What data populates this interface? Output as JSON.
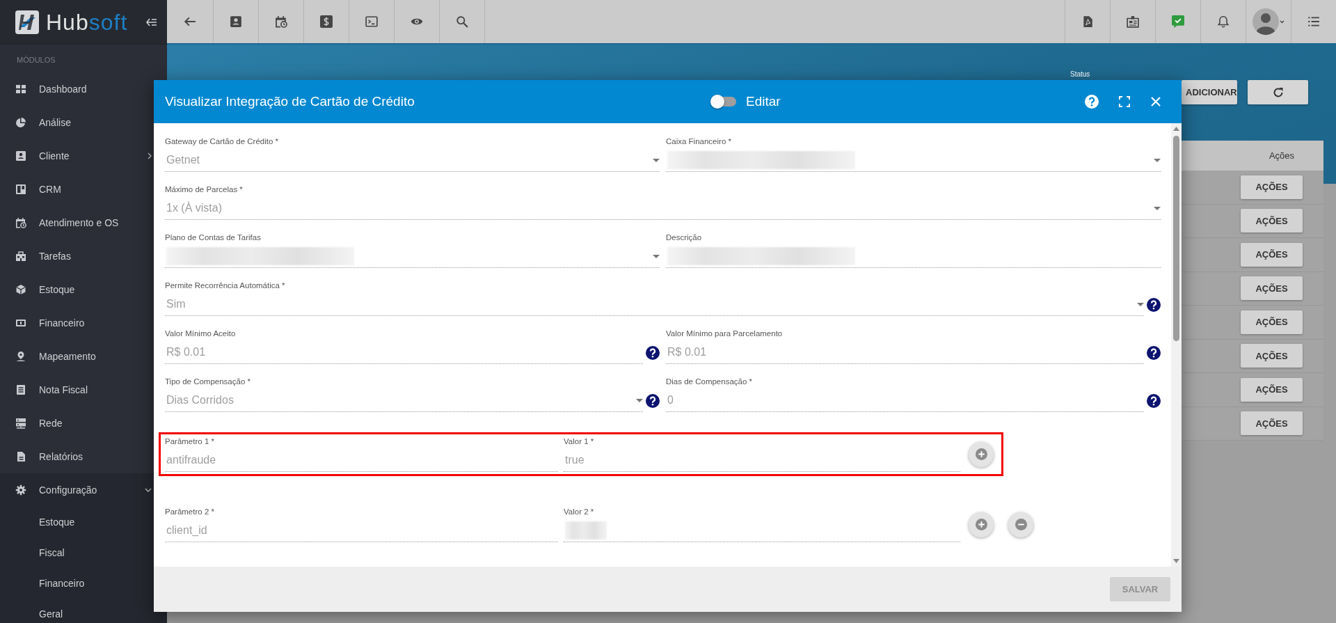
{
  "sidebar": {
    "brand": {
      "lead": "Hub",
      "accent": "soft"
    },
    "section_title": "MÓDULOS",
    "items": [
      {
        "label": "Dashboard"
      },
      {
        "label": "Análise"
      },
      {
        "label": "Cliente",
        "expanded": false
      },
      {
        "label": "CRM"
      },
      {
        "label": "Atendimento e OS"
      },
      {
        "label": "Tarefas"
      },
      {
        "label": "Estoque"
      },
      {
        "label": "Financeiro"
      },
      {
        "label": "Mapeamento"
      },
      {
        "label": "Nota Fiscal"
      },
      {
        "label": "Rede"
      },
      {
        "label": "Relatórios"
      },
      {
        "label": "Configuração",
        "expanded": true,
        "children": [
          {
            "label": "Estoque"
          },
          {
            "label": "Fiscal"
          },
          {
            "label": "Financeiro"
          },
          {
            "label": "Geral"
          }
        ]
      }
    ]
  },
  "page": {
    "status_label": "Status",
    "add_button": "ADICIONAR",
    "table": {
      "columns": [
        "Ações"
      ],
      "rows": [
        {
          "action": "AÇÕES"
        },
        {
          "action": "AÇÕES"
        },
        {
          "action": "AÇÕES"
        },
        {
          "action": "AÇÕES"
        },
        {
          "action": "AÇÕES"
        },
        {
          "action": "AÇÕES"
        },
        {
          "action": "AÇÕES"
        },
        {
          "action": "AÇÕES"
        }
      ]
    }
  },
  "modal": {
    "title": "Visualizar Integração de Cartão de Crédito",
    "edit_toggle": {
      "label": "Editar",
      "on": false
    },
    "rows": [
      {
        "fields": [
          {
            "label": "Gateway de Cartão de Crédito *",
            "value": "Getnet",
            "kind": "select",
            "help": false
          },
          {
            "label": "Caixa Financeiro *",
            "redacted": true,
            "kind": "select",
            "help": false
          }
        ]
      },
      {
        "fields": [
          {
            "label": "Máximo de Parcelas *",
            "value": "1x (À vista)",
            "kind": "select",
            "help": false
          }
        ]
      },
      {
        "fields": [
          {
            "label": "Plano de Contas de Tarifas",
            "redacted": true,
            "kind": "select",
            "help": false
          },
          {
            "label": "Descrição",
            "redacted": true,
            "kind": "text",
            "help": false
          }
        ]
      },
      {
        "fields": [
          {
            "label": "Permite Recorrência Automática *",
            "value": "Sim",
            "kind": "select",
            "help": true
          }
        ]
      },
      {
        "fields": [
          {
            "label": "Valor Mínimo Aceito",
            "value": "R$ 0.01",
            "kind": "text",
            "help": true
          },
          {
            "label": "Valor Mínimo para Parcelamento",
            "value": "R$ 0.01",
            "kind": "text",
            "help": true
          }
        ]
      },
      {
        "fields": [
          {
            "label": "Tipo de Compensação *",
            "value": "Dias Corridos",
            "kind": "select",
            "help": true
          },
          {
            "label": "Dias de Compensação *",
            "value": "0",
            "kind": "text",
            "help": true
          }
        ]
      }
    ],
    "parameters": [
      {
        "name_label": "Parâmetro 1 *",
        "name_value": "antifraude",
        "value_label": "Valor 1 *",
        "value": "true",
        "highlighted": true,
        "removable": false
      },
      {
        "name_label": "Parâmetro 2 *",
        "name_value": "client_id",
        "value_label": "Valor 2 *",
        "value_redacted": true,
        "highlighted": false,
        "removable": true
      }
    ],
    "save_button": {
      "label": "SALVAR",
      "disabled": true
    }
  }
}
